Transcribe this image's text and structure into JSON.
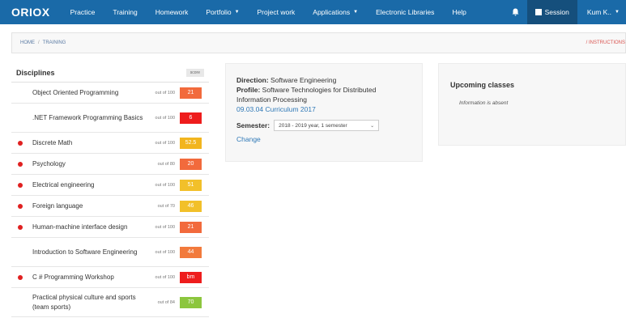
{
  "navbar": {
    "brand": "ORIOX",
    "items": [
      {
        "label": "Practice",
        "dropdown": false
      },
      {
        "label": "Training",
        "dropdown": false
      },
      {
        "label": "Homework",
        "dropdown": false
      },
      {
        "label": "Portfolio",
        "dropdown": true
      },
      {
        "label": "Project work",
        "dropdown": false
      },
      {
        "label": "Applications",
        "dropdown": true
      },
      {
        "label": "Electronic Libraries",
        "dropdown": false
      },
      {
        "label": "Help",
        "dropdown": false
      }
    ],
    "session_label": "Session",
    "user_label": "Kum K..",
    "icons": [
      "bell-icon",
      "calendar-icon",
      "chevron-down-icon"
    ]
  },
  "breadcrumb": {
    "home": "HOME",
    "sep": "/",
    "current": "TRAINING",
    "instructions": "/ INSTRUCTIONS"
  },
  "disciplines": {
    "title": "Disciplines",
    "score_header": "score",
    "rows": [
      {
        "name": "Object Oriented Programming",
        "out_of": "out of 100",
        "score": "21",
        "marked": false,
        "color": "#f26a3c"
      },
      {
        "name": ".NET Framework Programming Basics",
        "out_of": "out of 100",
        "score": "6",
        "marked": false,
        "color": "#ee1c1c"
      },
      {
        "name": "Discrete Math",
        "out_of": "out of 100",
        "score": "52.5",
        "marked": true,
        "color": "#f2b51e"
      },
      {
        "name": "Psychology",
        "out_of": "out of 80",
        "score": "20",
        "marked": true,
        "color": "#f26a3c"
      },
      {
        "name": "Electrical engineering",
        "out_of": "out of 100",
        "score": "51",
        "marked": true,
        "color": "#f2c02a"
      },
      {
        "name": "Foreign language",
        "out_of": "out of 70",
        "score": "46",
        "marked": true,
        "color": "#f2c02a"
      },
      {
        "name": "Human-machine interface design",
        "out_of": "out of 100",
        "score": "21",
        "marked": true,
        "color": "#f26a3c"
      },
      {
        "name": "Introduction to Software Engineering",
        "out_of": "out of 100",
        "score": "44",
        "marked": false,
        "color": "#f27a3c"
      },
      {
        "name": "C # Programming Workshop",
        "out_of": "out of 100",
        "score": "bm",
        "marked": true,
        "color": "#ee1c1c"
      },
      {
        "name": "Practical physical culture and sports (team sports)",
        "out_of": "out of 84",
        "score": "70",
        "marked": false,
        "color": "#8cc63e"
      }
    ]
  },
  "direction": {
    "direction_label": "Direction:",
    "direction_value": "Software Engineering",
    "profile_label": "Profile:",
    "profile_value": "Software Technologies for Distributed Information Processing",
    "curriculum_link": "09.03.04 Curriculum 2017",
    "semester_label": "Semester:",
    "semester_value": "2018 - 2019 year, 1 semester",
    "change_link": "Change"
  },
  "upcoming": {
    "title": "Upcoming classes",
    "empty_text": "Information is absent"
  }
}
